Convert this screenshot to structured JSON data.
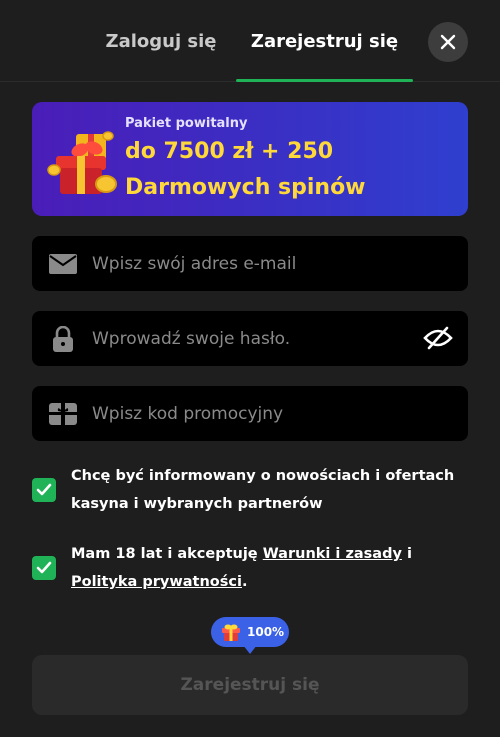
{
  "tabs": {
    "login_label": "Zaloguj się",
    "register_label": "Zarejestruj się",
    "active": "register"
  },
  "bonus": {
    "subtitle": "Pakiet powitalny",
    "line1": "do 7500 zł + 250",
    "line2": "Darmowych spinów",
    "icon": "gift-icon"
  },
  "form": {
    "email": {
      "placeholder": "Wpisz swój adres e-mail",
      "value": "",
      "icon": "envelope-icon"
    },
    "password": {
      "placeholder": "Wprowadź swoje hasło.",
      "value": "",
      "icon": "lock-icon",
      "toggle_icon": "eye-off-icon"
    },
    "promo": {
      "placeholder": "Wpisz kod promocyjny",
      "value": "",
      "icon": "gift-card-icon"
    }
  },
  "checkboxes": {
    "news": {
      "checked": true,
      "label": "Chcę być informowany o nowościach i ofertach kasyna i wybranych partnerów"
    },
    "terms": {
      "checked": true,
      "text_before": "Mam 18 lat i akceptuję ",
      "terms_link": "Warunki i zasady",
      "text_middle": " i ",
      "privacy_link": "Polityka prywatności",
      "text_after": "."
    }
  },
  "progress": {
    "label": "100%",
    "value": 100
  },
  "submit": {
    "label": "Zarejestruj się",
    "enabled": false
  },
  "colors": {
    "background": "#1e1e1e",
    "accent_green": "#1fb256",
    "banner_purple": "#4a1db8",
    "banner_yellow": "#ffd83a",
    "tooltip_blue": "#3b62e6",
    "input_bg": "#000000"
  }
}
